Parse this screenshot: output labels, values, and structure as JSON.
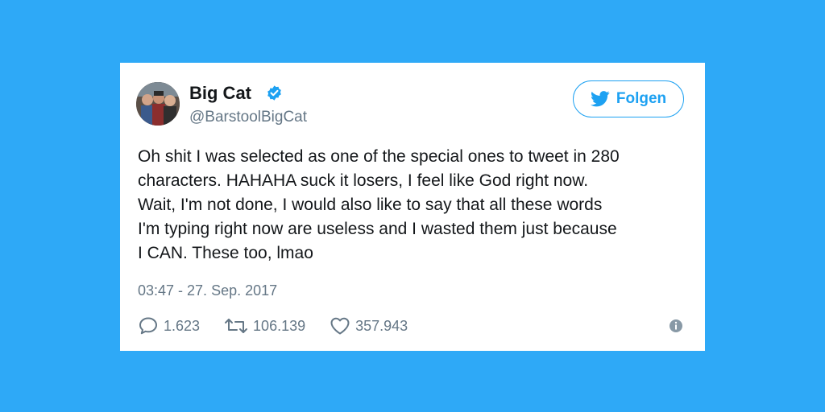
{
  "tweet": {
    "display_name": "Big Cat",
    "handle": "@BarstoolBigCat",
    "follow_label": "Folgen",
    "text_lines": [
      "Oh shit I was selected as one of the special ones to tweet in 280",
      "characters. HAHAHA suck it losers, I feel like God right now.",
      "Wait, I'm not done, I would also like to say that all these words",
      "I'm typing right now are useless and I wasted them just because",
      "I CAN. These too, lmao"
    ],
    "timestamp": "03:47 - 27. Sep. 2017",
    "replies": "1.623",
    "retweets": "106.139",
    "likes": "357.943"
  },
  "colors": {
    "background": "#2ea9f7",
    "accent": "#1da1f2",
    "text": "#14171a",
    "muted": "#657786"
  },
  "icons": {
    "verified": "verified-badge-icon",
    "follow": "twitter-bird-icon",
    "reply": "speech-bubble-icon",
    "retweet": "retweet-arrows-icon",
    "like": "heart-icon",
    "info": "info-icon"
  }
}
